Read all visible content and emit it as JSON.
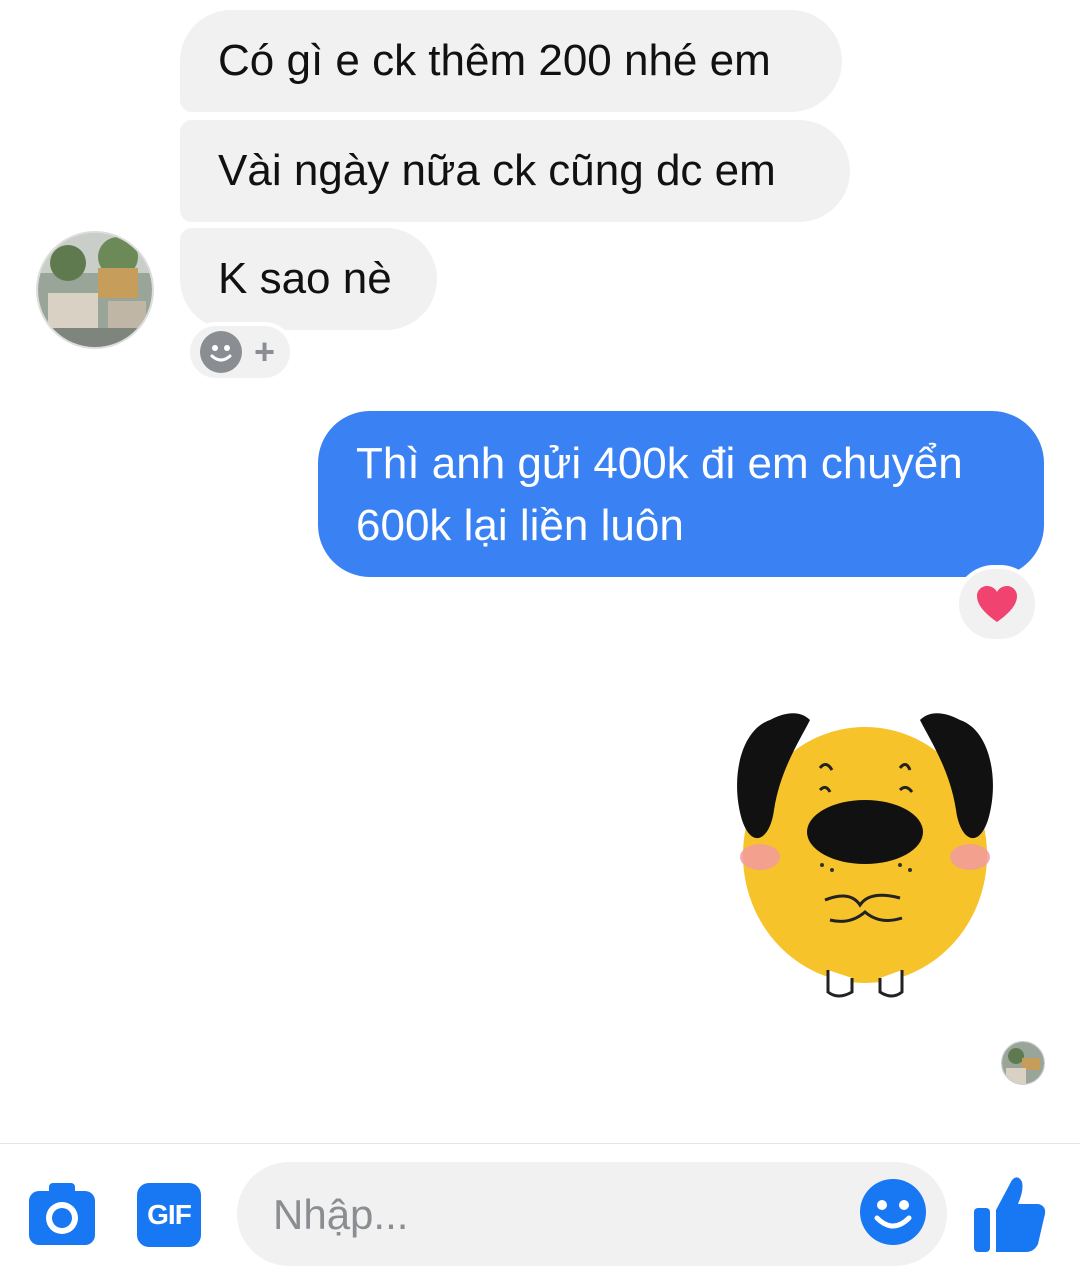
{
  "messages_in": [
    {
      "text": "Có gì e ck thêm 200 nhé em"
    },
    {
      "text": "Vài ngày nữa ck cũng dc em"
    },
    {
      "text": "K sao nè"
    }
  ],
  "add_reaction": {
    "plus": "+"
  },
  "message_out": {
    "line1": "Thì anh gửi 400k đi em chuyển",
    "line2": "600k lại liền luôn"
  },
  "composer": {
    "gif_label": "GIF",
    "placeholder": "Nhập..."
  },
  "colors": {
    "accent": "#1877f2",
    "bubble_out": "#3a82f3",
    "bubble_in": "#f1f1f2",
    "heart": "#f0436f"
  },
  "icons": [
    "camera-icon",
    "gif-icon",
    "emoji-icon",
    "thumbs-up-icon",
    "heart-icon",
    "smiley-icon",
    "plus-icon"
  ]
}
